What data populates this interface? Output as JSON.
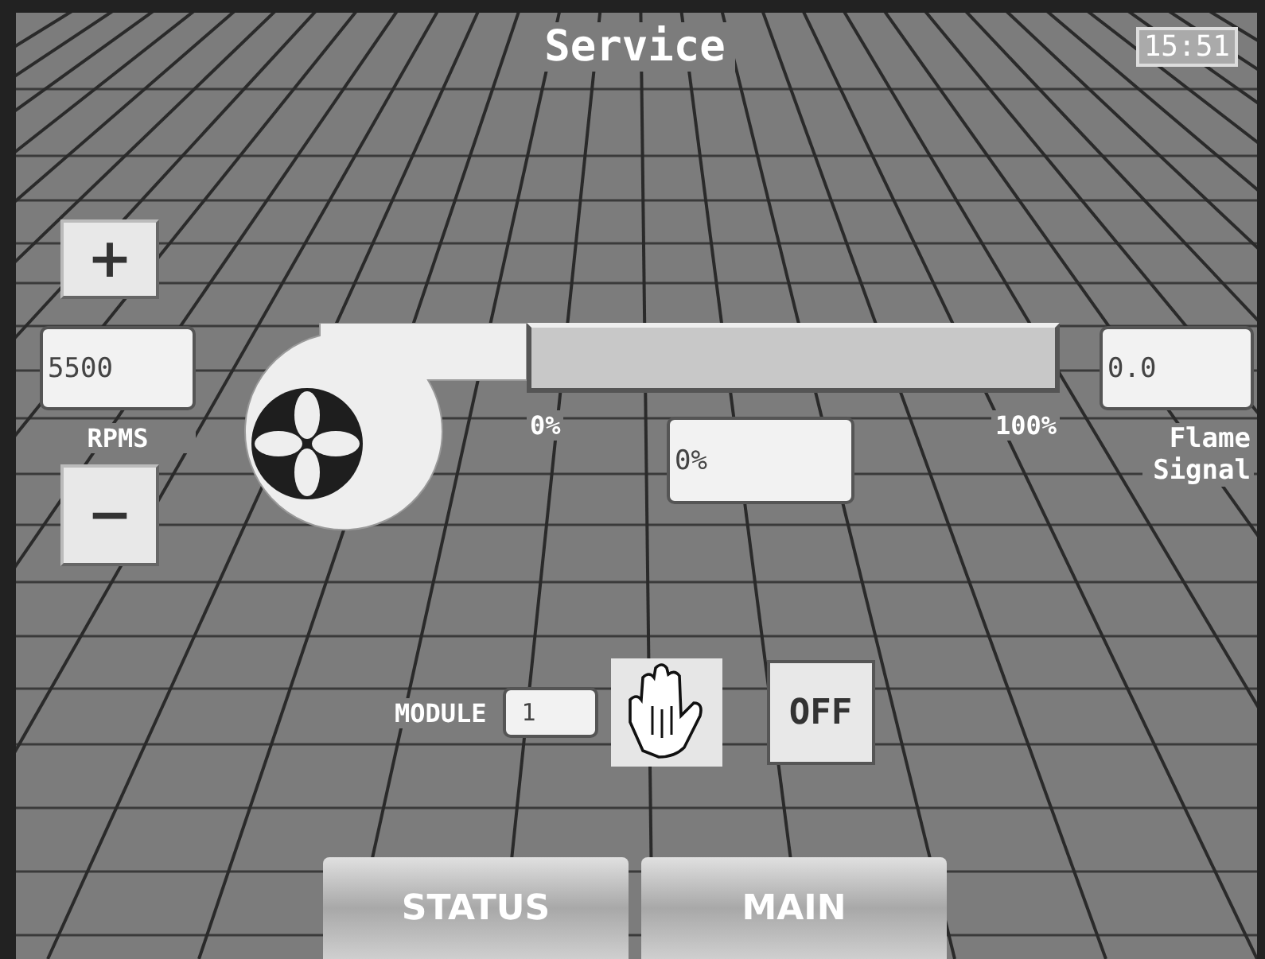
{
  "title": "Service",
  "clock": "15:51",
  "speed": {
    "increase_label": "+",
    "value": "5500",
    "label": "RPMS",
    "decrease_label": "−"
  },
  "firing_rate": {
    "level": 0,
    "min_label": "0%",
    "max_label": "100%",
    "value": "0%"
  },
  "flame_signal": {
    "value": "0.0",
    "label": "Flame Signal"
  },
  "module": {
    "label": "MODULE",
    "value": "1",
    "mode_button": "OFF"
  },
  "tabs": [
    {
      "label": "STATUS"
    },
    {
      "label": "MAIN"
    }
  ]
}
